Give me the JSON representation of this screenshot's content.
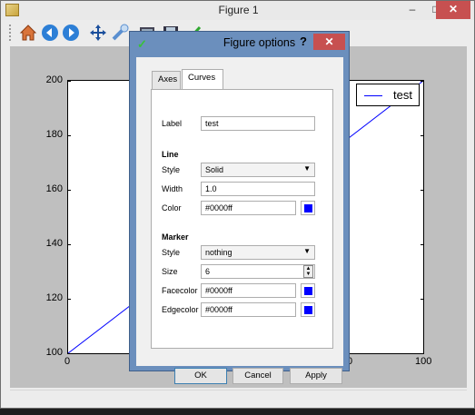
{
  "window": {
    "title": "Figure 1",
    "minimize": "–",
    "maximize": "□",
    "close": "✕"
  },
  "toolbar": {
    "icons": [
      "home-icon",
      "back-icon",
      "forward-icon",
      "pan-icon",
      "zoom-icon",
      "subplots-icon",
      "save-icon",
      "figure-options-icon"
    ]
  },
  "dialog": {
    "title": "Figure options",
    "help": "?",
    "close": "✕",
    "tabs": [
      {
        "label": "Axes"
      },
      {
        "label": "Curves"
      }
    ],
    "curve_select": "test",
    "label_label": "Label",
    "label_value": "test",
    "line_section": "Line",
    "style_label": "Style",
    "line_style": "Solid",
    "width_label": "Width",
    "width_value": "1.0",
    "color_label": "Color",
    "color_value": "#0000ff",
    "marker_section": "Marker",
    "marker_style_label": "Style",
    "marker_style": "nothing",
    "size_label": "Size",
    "size_value": "6",
    "facecolor_label": "Facecolor",
    "facecolor_value": "#0000ff",
    "edgecolor_label": "Edgecolor",
    "edgecolor_value": "#0000ff",
    "ok": "OK",
    "cancel": "Cancel",
    "apply": "Apply"
  },
  "colors": {
    "accent": "#0000ff",
    "close_red": "#c75050",
    "dialog_frame": "#6b8fbd"
  },
  "chart_data": {
    "type": "line",
    "series": [
      {
        "name": "test",
        "x": [
          0,
          100
        ],
        "y": [
          100,
          200
        ],
        "color": "#0000ff"
      }
    ],
    "xlim": [
      0,
      100
    ],
    "ylim": [
      100,
      200
    ],
    "yticks": [
      "100",
      "120",
      "140",
      "160",
      "180",
      "200"
    ],
    "xticks_visible": [
      "0",
      "80",
      "100"
    ],
    "legend": "top-right",
    "grid": false
  }
}
